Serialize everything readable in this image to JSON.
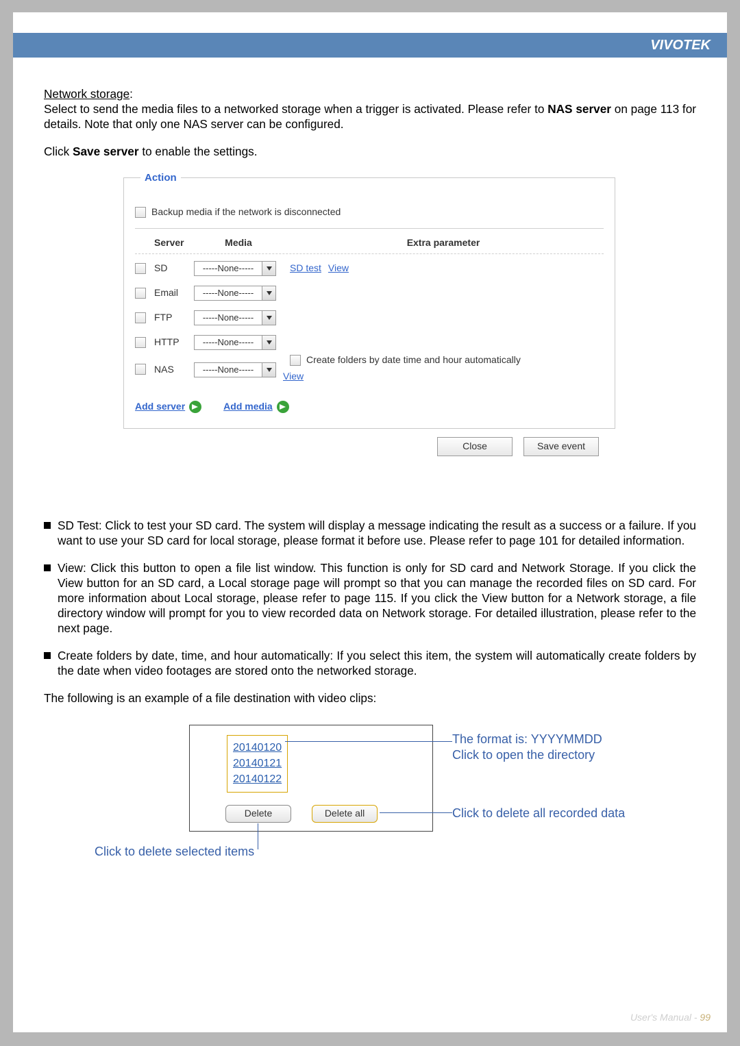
{
  "brand": "VIVOTEK",
  "intro": {
    "heading": "Network storage",
    "p1a": "Select to send the media files to a networked storage when a trigger is activated. Please refer to ",
    "p1b": "NAS server",
    "p1c": " on page 113 for details. Note that only one NAS server can be configured.",
    "p2a": "Click ",
    "p2b": "Save server",
    "p2c": " to enable the settings."
  },
  "action": {
    "legend": "Action",
    "backup_label": "Backup media if the network is disconnected",
    "headers": {
      "server": "Server",
      "media": "Media",
      "extra": "Extra parameter"
    },
    "none": "-----None-----",
    "rows": {
      "sd": {
        "label": "SD",
        "extra_links": {
          "sdtest": "SD test",
          "view": "View"
        }
      },
      "email": {
        "label": "Email"
      },
      "ftp": {
        "label": "FTP"
      },
      "http": {
        "label": "HTTP"
      },
      "nas": {
        "label": "NAS",
        "create_label": "Create folders by date time and hour automatically",
        "view": "View"
      }
    },
    "add_server": "Add server",
    "add_media": "Add media",
    "close": "Close",
    "save_event": "Save event"
  },
  "bullets": {
    "sd": "SD Test: Click to test your SD card. The system will display a message indicating the result as a success or a failure. If you want to use your SD card for local storage, please format it before use. Please refer to page 101 for detailed information.",
    "view": "View: Click this button to open a file list window. This function is only for SD card and Network Storage. If you click the View button for an SD card, a Local storage page will prompt so that you can manage the recorded files on SD card. For more information about Local storage, please refer to page 115. If you click the View button for a Network storage, a file directory window will prompt for you to view recorded data on Network storage. For detailed illustration, please refer to the next page.",
    "create": "Create folders by date, time, and hour automatically: If you select this item, the system will automatically create folders by the date when video footages are stored onto the networked storage."
  },
  "follow": "The following is an example of a file destination with video clips:",
  "diagram": {
    "folders": [
      "20140120",
      "20140121",
      "20140122"
    ],
    "delete": "Delete",
    "delete_all": "Delete all",
    "annot_format_1": "The format is: YYYYMMDD",
    "annot_format_2": "Click to open the directory",
    "annot_delall": "Click to delete all recorded data",
    "annot_del": "Click to delete selected items"
  },
  "footer": {
    "label": "User's Manual - ",
    "page": "99"
  }
}
